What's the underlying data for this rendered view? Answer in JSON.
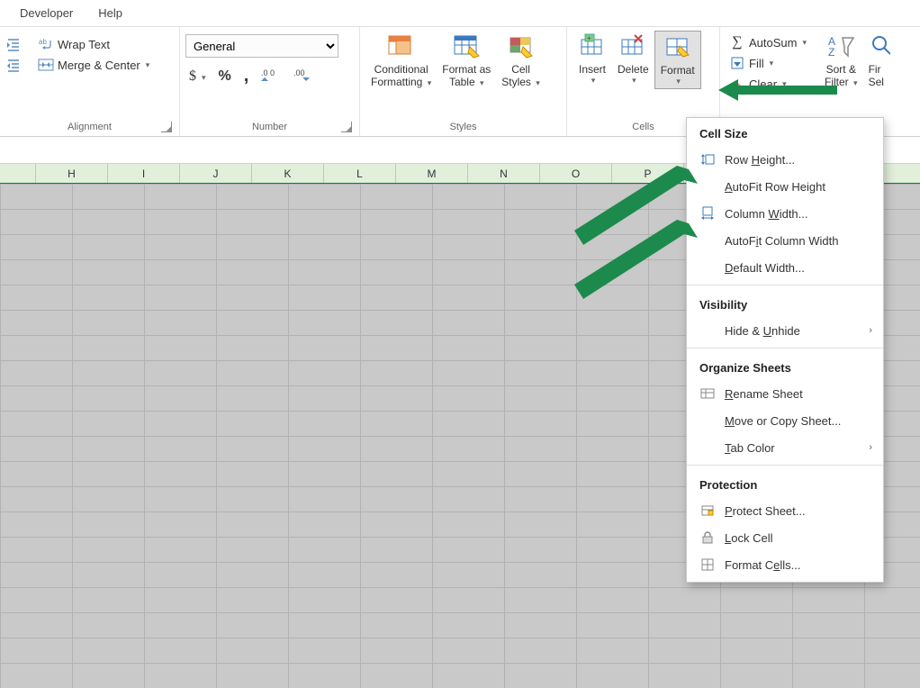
{
  "menu": {
    "developer": "Developer",
    "help": "Help"
  },
  "alignment": {
    "wrap_text": "Wrap Text",
    "merge_center": "Merge & Center",
    "label": "Alignment"
  },
  "number": {
    "format_selected": "General",
    "label": "Number"
  },
  "styles": {
    "cond_fmt_l1": "Conditional",
    "cond_fmt_l2": "Formatting",
    "fmt_table_l1": "Format as",
    "fmt_table_l2": "Table",
    "cell_styles_l1": "Cell",
    "cell_styles_l2": "Styles",
    "label": "Styles"
  },
  "cells": {
    "insert": "Insert",
    "delete": "Delete",
    "format": "Format",
    "label": "Cells"
  },
  "editing": {
    "autosum": "AutoSum",
    "fill": "Fill",
    "clear": "Clear",
    "sort_l1": "Sort &",
    "sort_l2": "Filter",
    "find_l1": "Fir",
    "find_l2": "Sel"
  },
  "columns": [
    "H",
    "I",
    "J",
    "K",
    "L",
    "M",
    "N",
    "O",
    "P"
  ],
  "dropdown": {
    "s1": "Cell Size",
    "row_height": "Row Height...",
    "autofit_row": "AutoFit Row Height",
    "col_width": "Column Width...",
    "autofit_col": "AutoFit Column Width",
    "default_width": "Default Width...",
    "s2": "Visibility",
    "hide_unhide": "Hide & Unhide",
    "s3": "Organize Sheets",
    "rename": "Rename Sheet",
    "move_copy": "Move or Copy Sheet...",
    "tab_color": "Tab Color",
    "s4": "Protection",
    "protect": "Protect Sheet...",
    "lock": "Lock Cell",
    "format_cells": "Format Cells..."
  }
}
